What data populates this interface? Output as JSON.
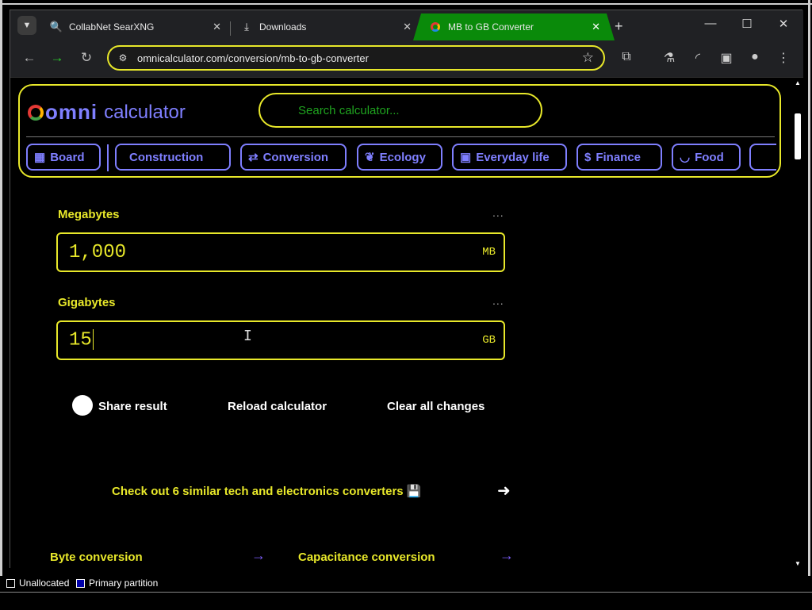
{
  "browser": {
    "tabs": [
      {
        "title": "CollabNet SearXNG",
        "icon": "search-icon"
      },
      {
        "title": "Downloads",
        "icon": "download-icon"
      },
      {
        "title": "MB to GB Converter",
        "icon": "omni-favicon",
        "active": true
      }
    ],
    "url": "omnicalculator.com/conversion/mb-to-gb-converter",
    "accent": "#0a8a0a",
    "highlight": "#e8e82a"
  },
  "omni": {
    "brand_mark": "omni",
    "brand_word": "calculator",
    "search_placeholder": "Search calculator...",
    "categories": [
      "Board",
      "Construction",
      "Conversion",
      "Ecology",
      "Everyday life",
      "Finance",
      "Food"
    ]
  },
  "calculator": {
    "fields": [
      {
        "label": "Megabytes",
        "value": "1,000",
        "unit": "MB",
        "more": "..."
      },
      {
        "label": "Gigabytes",
        "value": "15",
        "unit": "GB",
        "more": "..."
      }
    ],
    "actions": {
      "share": "Share result",
      "reload": "Reload calculator",
      "clear": "Clear all changes"
    },
    "similar_text": "Check out 6 similar tech and electronics converters 💾",
    "related": [
      {
        "label": "Byte conversion"
      },
      {
        "label": "Capacitance conversion"
      }
    ]
  },
  "status_bar": {
    "legend": [
      {
        "label": "Unallocated",
        "color": "#000000"
      },
      {
        "label": "Primary partition",
        "color": "#0000aa"
      }
    ]
  }
}
